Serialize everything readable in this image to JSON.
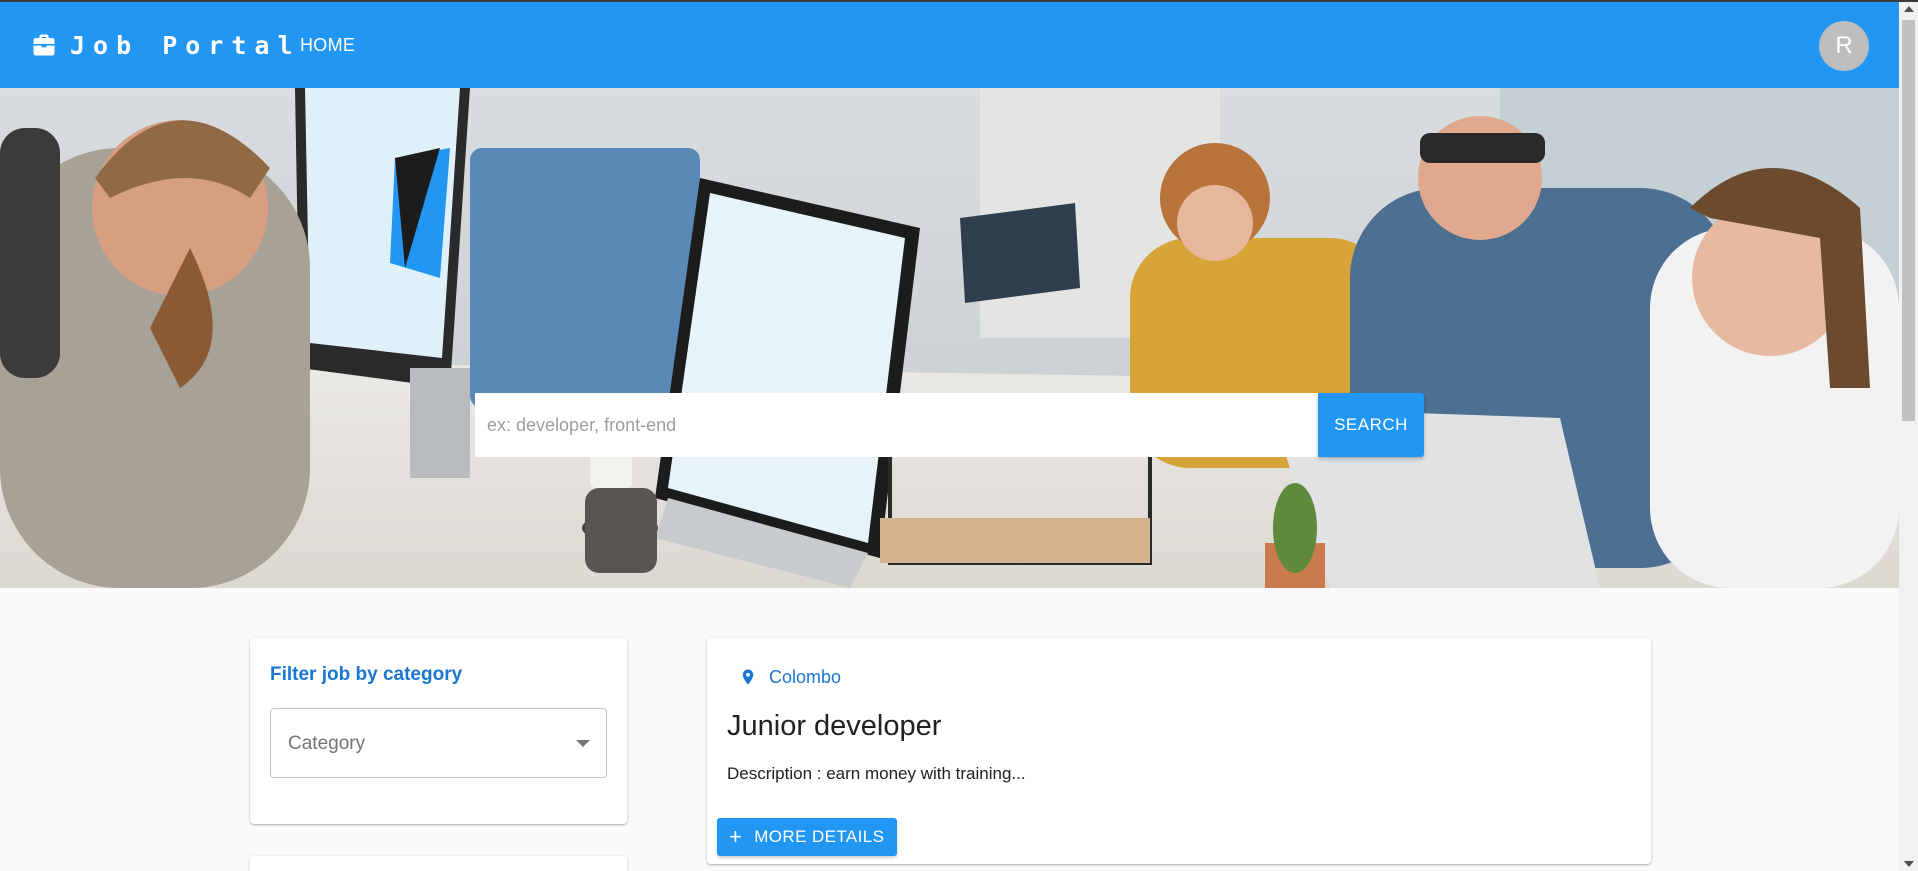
{
  "appbar": {
    "brand_title": "Job Portal",
    "brand_icon": "briefcase-icon",
    "nav_home": "HOME",
    "avatar_letter": "R",
    "color": "#2196f3"
  },
  "hero": {
    "image": "office-team-photo",
    "search": {
      "placeholder": "ex: developer, front-end",
      "value": "",
      "button_label": "SEARCH"
    }
  },
  "filter": {
    "title": "Filter job by category",
    "select_label": "Category",
    "select_icon": "arrow-drop-down-icon"
  },
  "jobs": [
    {
      "location": "Colombo",
      "location_icon": "location-pin-icon",
      "title": "Junior developer",
      "description": "Description : earn money with training...",
      "button_label": "MORE DETAILS",
      "button_icon": "plus-icon"
    }
  ],
  "colors": {
    "primary": "#2196f3",
    "link": "#1976d2"
  }
}
